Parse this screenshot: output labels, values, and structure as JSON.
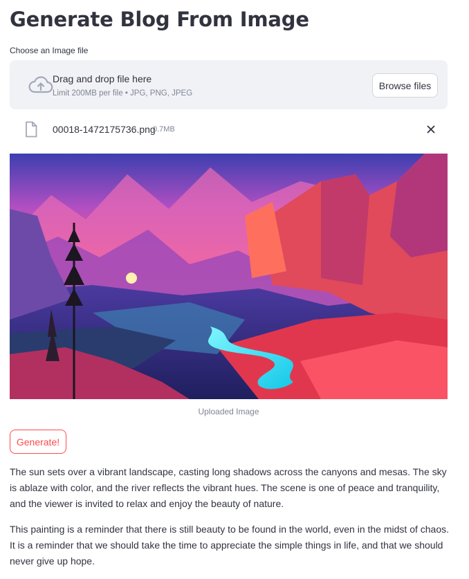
{
  "page": {
    "title": "Generate Blog From Image"
  },
  "uploader": {
    "label": "Choose an Image file",
    "drop_text": "Drag and drop file here",
    "limit_text": "Limit 200MB per file • JPG, PNG, JPEG",
    "browse_label": "Browse files",
    "upload_icon": "cloud-upload-icon"
  },
  "file": {
    "name": "00018-1472175736.png",
    "size": "0.7MB",
    "file_icon": "file-icon",
    "remove_icon": "close-icon"
  },
  "image": {
    "caption": "Uploaded Image"
  },
  "actions": {
    "generate_label": "Generate!"
  },
  "blog": {
    "paragraphs": [
      "The sun sets over a vibrant landscape, casting long shadows across the canyons and mesas. The sky is ablaze with color, and the river reflects the vibrant hues. The scene is one of peace and tranquility, and the viewer is invited to relax and enjoy the beauty of nature.",
      "This painting is a reminder that there is still beauty to be found in the world, even in the midst of chaos. It is a reminder that we should take the time to appreciate the simple things in life, and that we should never give up hope."
    ]
  },
  "colors": {
    "primary": "#ff4b4b",
    "text": "#31333f",
    "muted": "#808495",
    "dropzone_bg": "#f0f2f6"
  }
}
